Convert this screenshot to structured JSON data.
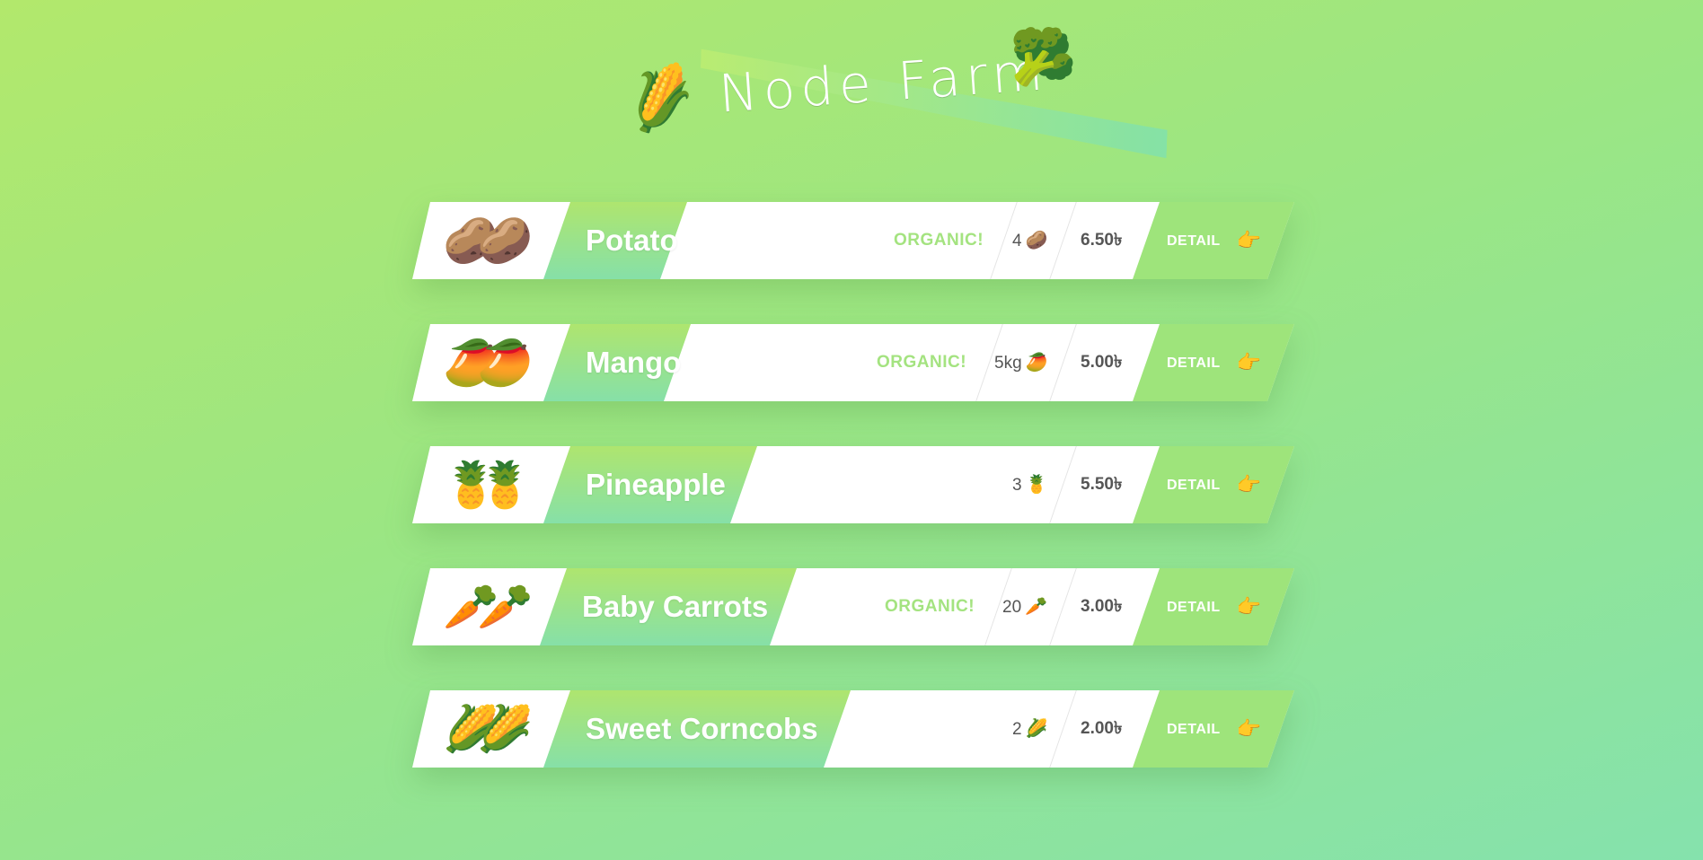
{
  "header": {
    "title": "Node Farm",
    "left_icon": "corn-emoji",
    "left_glyph": "🌽",
    "right_icon": "broccoli-emoji",
    "right_glyph": "🥦"
  },
  "products": [
    {
      "name": "Potato",
      "image": "🥔🥔",
      "organic": "ORGANIC!",
      "quantity": "4",
      "qty_icon": "🥔",
      "price": "6.50৳",
      "detail_label": "DETAIL",
      "detail_icon": "👉"
    },
    {
      "name": "Mango",
      "image": "🥭🥭",
      "organic": "ORGANIC!",
      "quantity": "5kg",
      "qty_icon": "🥭",
      "price": "5.00৳",
      "detail_label": "DETAIL",
      "detail_icon": "👉"
    },
    {
      "name": "Pineapple",
      "image": "🍍🍍",
      "organic": "",
      "quantity": "3",
      "qty_icon": "🍍",
      "price": "5.50৳",
      "detail_label": "DETAIL",
      "detail_icon": "👉"
    },
    {
      "name": "Baby Carrots",
      "image": "🥕🥕",
      "organic": "ORGANIC!",
      "quantity": "20",
      "qty_icon": "🥕",
      "price": "3.00৳",
      "detail_label": "DETAIL",
      "detail_icon": "👉"
    },
    {
      "name": "Sweet Corncobs",
      "image": "🌽🌽",
      "organic": "",
      "quantity": "2",
      "qty_icon": "🌽",
      "price": "2.00৳",
      "detail_label": "DETAIL",
      "detail_icon": "👉"
    }
  ],
  "colors": {
    "accent": "#9ee47b",
    "organic": "#a4e380",
    "text": "#555555"
  }
}
